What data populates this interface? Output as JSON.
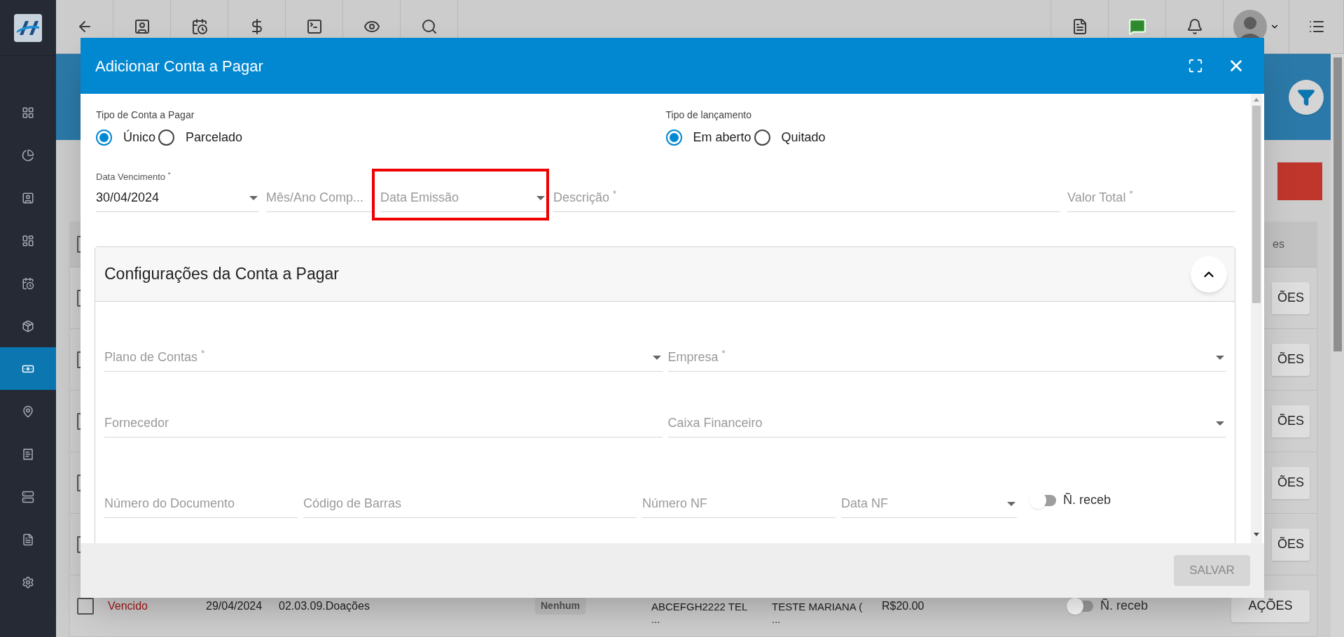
{
  "sidebar": {
    "items": [
      {
        "selected": false
      },
      {
        "selected": false
      },
      {
        "selected": false
      },
      {
        "selected": false
      },
      {
        "selected": false
      },
      {
        "selected": false
      },
      {
        "selected": true
      },
      {
        "selected": false
      },
      {
        "selected": false
      },
      {
        "selected": false
      },
      {
        "selected": false
      },
      {
        "selected": false
      }
    ]
  },
  "background": {
    "table": {
      "header_fragment": "es",
      "header_checked": false,
      "rows": [
        {
          "kind": "partial",
          "checked": false,
          "action": "ÕES"
        },
        {
          "kind": "partial",
          "checked": false,
          "action": "ÕES"
        },
        {
          "kind": "partial",
          "checked": false,
          "action": "ÕES"
        },
        {
          "kind": "partial",
          "checked": false,
          "action": "ÕES"
        },
        {
          "kind": "partial",
          "checked": false,
          "action": "ÕES"
        },
        {
          "kind": "full",
          "checked": false,
          "status": "Vencido",
          "date": "29/04/2024",
          "account": "02.03.09.Doações",
          "tag": "Nenhum",
          "column_5": [
            "ABCEFGH2222 TEL",
            "..."
          ],
          "column_6": [
            "TESTE MARIANA (",
            "..."
          ],
          "value": "R$20.00",
          "toggle": {
            "label": "Ñ. receb",
            "on": false
          },
          "action": "AÇÕES"
        }
      ]
    }
  },
  "dialog": {
    "title": "Adicionar Conta a Pagar",
    "radio_groups": [
      {
        "label": "Tipo de Conta a Pagar",
        "options": [
          {
            "label": "Único",
            "selected": true
          },
          {
            "label": "Parcelado",
            "selected": false
          }
        ]
      },
      {
        "label": "Tipo de lançamento",
        "options": [
          {
            "label": "Em aberto",
            "selected": true
          },
          {
            "label": "Quitado",
            "selected": false
          }
        ]
      }
    ],
    "fields": [
      {
        "label": "Data Vencimento $^{*}$",
        "value": "30/04/2024",
        "dropdown": true,
        "highlighted": false
      },
      {
        "label": "Mês/Ano Comp...",
        "dropdown": false,
        "highlighted": false
      },
      {
        "label": "Data Emissão",
        "dropdown": true,
        "highlighted": true
      },
      {
        "label": "Descrição $^{*}$",
        "dropdown": false,
        "highlighted": false
      },
      {
        "label": "Valor Total $^{*}$",
        "dropdown": false,
        "highlighted": false
      }
    ],
    "section": {
      "title": "Configurações da Conta a Pagar",
      "expanded": true,
      "rows": [
        [
          {
            "label": "Plano de Contas $^{*}$",
            "dropdown": true
          },
          {
            "label": "Empresa $^{*}$",
            "dropdown": true
          }
        ],
        [
          {
            "label": "Fornecedor",
            "dropdown": false
          },
          {
            "label": "Caixa Financeiro",
            "dropdown": true
          }
        ],
        [
          {
            "label": "Número do Documento",
            "dropdown": false
          },
          {
            "label": "Código de Barras",
            "dropdown": false
          },
          {
            "label": "Número NF",
            "dropdown": false
          },
          {
            "label": "Data NF",
            "dropdown": true
          },
          {
            "kind": "toggle",
            "label": "Ñ. receb",
            "on": false
          }
        ]
      ]
    },
    "save_button": {
      "label": "SALVAR",
      "disabled": true
    }
  }
}
